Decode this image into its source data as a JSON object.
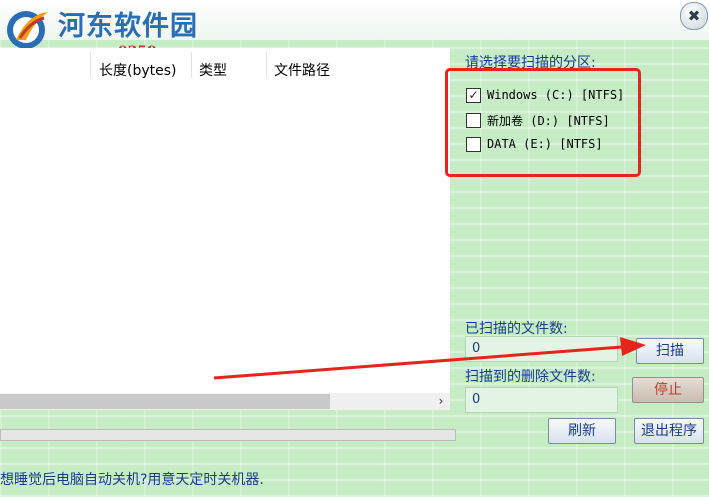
{
  "watermark": {
    "site_name": "河东软件园",
    "site_url": "www.pc0359.cn"
  },
  "window": {
    "close_symbol": "✖"
  },
  "file_list": {
    "columns": [
      "长度(bytes)",
      "类型",
      "文件路径"
    ],
    "scroll_right_arrow": "›"
  },
  "partitions": {
    "label": "请选择要扫描的分区:",
    "items": [
      {
        "label": "Windows (C:) [NTFS]",
        "checked": true
      },
      {
        "label": "新加卷 (D:) [NTFS]",
        "checked": false
      },
      {
        "label": "DATA (E:) [NTFS]",
        "checked": false
      }
    ],
    "highlight_color": "#e8231c"
  },
  "scanned": {
    "label": "已扫描的文件数:",
    "value": "0"
  },
  "deleted": {
    "label": "扫描到的删除文件数:",
    "value": "0"
  },
  "buttons": {
    "scan": "扫描",
    "stop": "停止",
    "refresh": "刷新",
    "exit": "退出程序"
  },
  "status": {
    "text": "想睡觉后电脑自动关机?用意天定时关机器."
  },
  "colors": {
    "background": "#c6ecc6",
    "text_blue": "#1a3b8c",
    "annotation_red": "#e8231c"
  }
}
